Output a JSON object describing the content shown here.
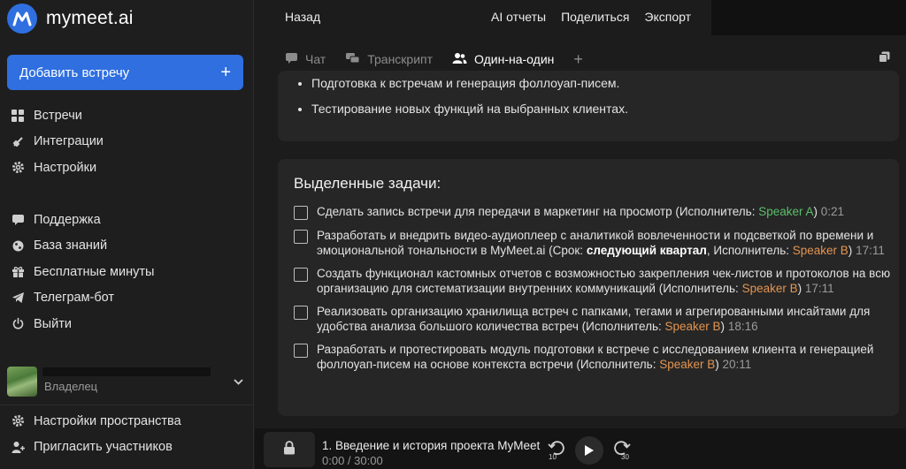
{
  "app": {
    "name": "mymeet.ai"
  },
  "sidebar": {
    "add_meeting_label": "Добавить встречу",
    "add_plus": "+",
    "nav_main": [
      {
        "label": "Встречи",
        "icon": "grid-icon"
      },
      {
        "label": "Интеграции",
        "icon": "plug-icon"
      },
      {
        "label": "Настройки",
        "icon": "gear-icon"
      }
    ],
    "nav_help": [
      {
        "label": "Поддержка",
        "icon": "chat-icon"
      },
      {
        "label": "База знаний",
        "icon": "globe-icon"
      },
      {
        "label": "Бесплатные минуты",
        "icon": "gift-icon"
      },
      {
        "label": "Телеграм-бот",
        "icon": "telegram-icon"
      },
      {
        "label": "Выйти",
        "icon": "power-icon"
      }
    ],
    "workspace": {
      "role": "Владелец"
    },
    "nav_bottom": [
      {
        "label": "Настройки пространства",
        "icon": "gear-icon"
      },
      {
        "label": "Пригласить участников",
        "icon": "user-plus-icon"
      }
    ]
  },
  "topbar": {
    "back_label": "Назад",
    "actions": [
      "AI отчеты",
      "Поделиться",
      "Экспорт"
    ]
  },
  "tabs": [
    {
      "label": "Чат",
      "active": false
    },
    {
      "label": "Транскрипт",
      "active": false
    },
    {
      "label": "Один-на-один",
      "active": true
    }
  ],
  "summary_bullets": [
    "Подготовка к встречам и генерация фоллоуап-писем.",
    "Тестирование новых функций на выбранных клиентах."
  ],
  "tasks_title": "Выделенные задачи:",
  "tasks": [
    {
      "pre": "Сделать запись встречи для передачи в маркетинг на просмотр (Исполнитель: ",
      "speaker": "Speaker A",
      "post": ")",
      "time": "0:21",
      "color": "green"
    },
    {
      "pre": "Разработать и внедрить видео-аудиоплеер с аналитикой вовлеченности и подсветкой по времени и эмоциональной тональности в MyMeet.ai (Срок: ",
      "bold": "следующий квартал",
      "mid": ", Исполнитель: ",
      "speaker": "Speaker B",
      "post": ")",
      "time": "17:11",
      "color": "orange"
    },
    {
      "pre": "Создать функционал кастомных отчетов с возможностью закрепления чек-листов и протоколов на всю организацию для систематизации внутренних коммуникаций (Исполнитель: ",
      "speaker": "Speaker B",
      "post": ")",
      "time": "17:11",
      "color": "orange"
    },
    {
      "pre": "Реализовать организацию хранилища встреч с папками, тегами и агрегированными инсайтами для удобства анализа большого количества встреч (Исполнитель: ",
      "speaker": "Speaker B",
      "post": ")",
      "time": "18:16",
      "color": "orange"
    },
    {
      "pre": "Разработать и протестировать модуль подготовки к встрече с исследованием клиента и генерацией фоллоуап-писем на основе контекста встречи (Исполнитель: ",
      "speaker": "Speaker B",
      "post": ")",
      "time": "20:11",
      "color": "orange"
    }
  ],
  "player": {
    "title": "1. Введение и история проекта MyMeet",
    "time": "0:00 / 30:00",
    "rewind_label": "10",
    "forward_label": "30"
  },
  "colors": {
    "accent": "#2f6fe0",
    "speaker_a": "#5bbf6a",
    "speaker_b": "#e39450"
  }
}
